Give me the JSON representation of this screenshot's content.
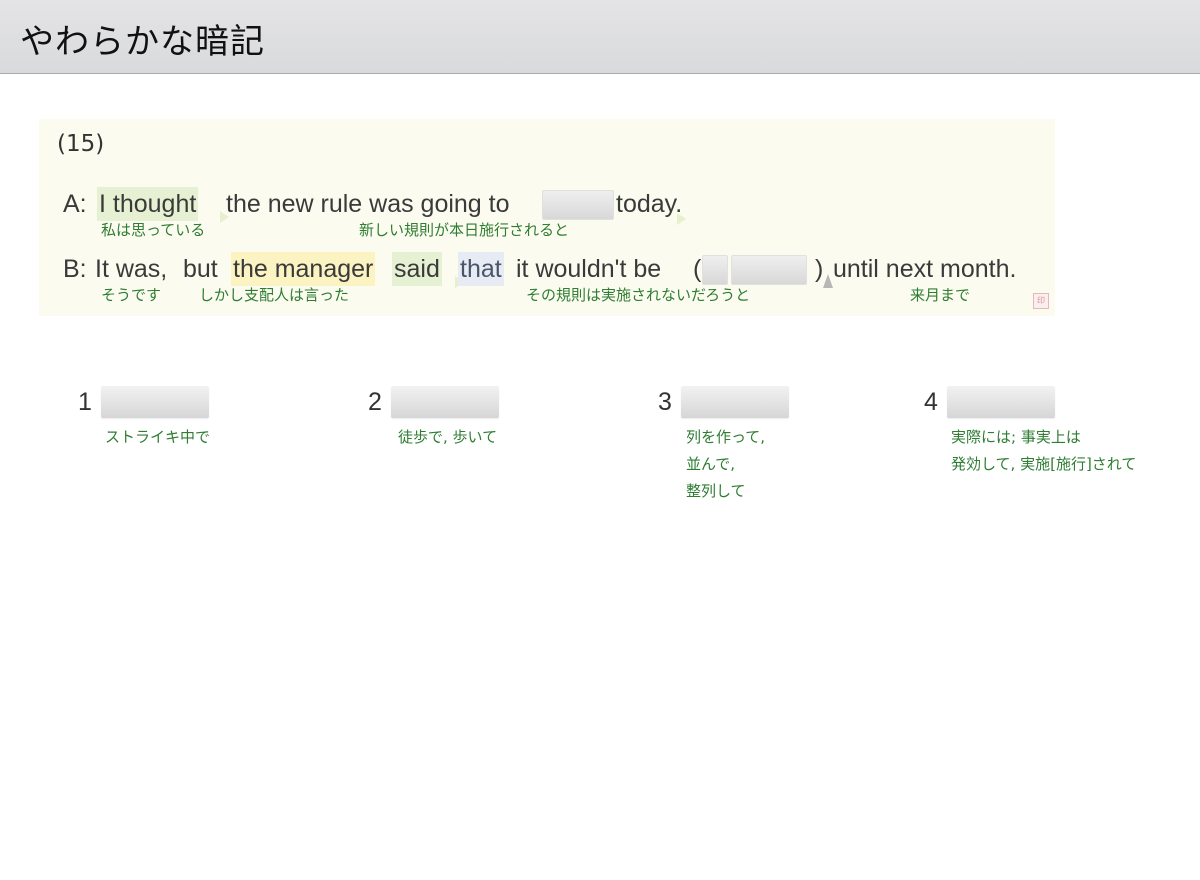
{
  "header": {
    "title": "やわらかな暗記"
  },
  "question": {
    "number": "(15)",
    "line_a": {
      "speaker": "A:",
      "words": [
        "I thought",
        "the new rule was going to",
        "today."
      ],
      "glosses": [
        "私は思っている",
        "新しい規則が本日施行されると"
      ]
    },
    "line_b": {
      "speaker": "B:",
      "words": [
        "It was,",
        "but",
        "the manager",
        "said",
        "that",
        "it wouldn't be",
        "(",
        ")",
        "until next month."
      ],
      "glosses": [
        "そうです",
        "しかし支配人は言った",
        "その規則は実施されないだろうと",
        "来月まで"
      ]
    }
  },
  "options": [
    {
      "number": "1",
      "gloss_lines": [
        "ストライキ中で"
      ]
    },
    {
      "number": "2",
      "gloss_lines": [
        "徒歩で, 歩いて"
      ]
    },
    {
      "number": "3",
      "gloss_lines": [
        "列を作って,",
        "並んで,",
        "整列して"
      ]
    },
    {
      "number": "4",
      "gloss_lines": [
        "実際には; 事実上は",
        "発効して, 実施[施行]されて"
      ]
    }
  ],
  "colors": {
    "gloss_green": "#2e7d32",
    "card_bg": "#fbfcef",
    "header_bg": "#dcdddf"
  }
}
